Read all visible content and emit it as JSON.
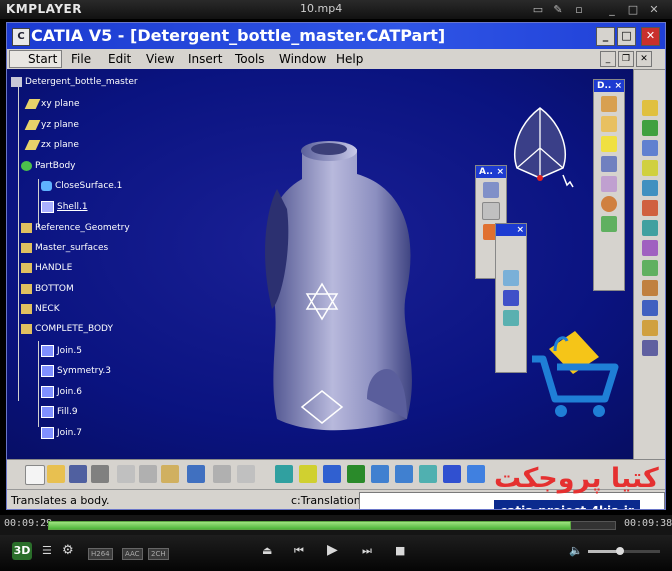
{
  "player": {
    "logo": "KMPLAYER",
    "file": "10.mp4",
    "time_current": "00:09:29",
    "time_total": "00:09:38",
    "progress": 0.92,
    "badges": [
      "H264",
      "AAC",
      "2CH"
    ],
    "btn_3d": "3D",
    "volume": 0.45
  },
  "catia": {
    "title": "CATIA V5 - [Detergent_bottle_master.CATPart]",
    "menu": [
      "Start",
      "File",
      "Edit",
      "View",
      "Insert",
      "Tools",
      "Window",
      "Help"
    ],
    "status_text": "Translates a body.",
    "cmd_label": "c:Translation",
    "cmd_value": ""
  },
  "tree": {
    "root": "Detergent_bottle_master",
    "items": [
      "xy plane",
      "yz plane",
      "zx plane",
      "PartBody",
      "CloseSurface.1",
      "Shell.1",
      "Reference_Geometry",
      "Master_surfaces",
      "HANDLE",
      "BOTTOM",
      "NECK",
      "COMPLETE_BODY",
      "Join.5",
      "Symmetry.3",
      "Join.6",
      "Fill.9",
      "Join.7"
    ]
  },
  "toolbars": {
    "d_label": "D..",
    "a_label": "A..",
    "close": "×"
  },
  "watermark": {
    "title": "کتیا پروجکت",
    "url": "catia-project.4kia.ir"
  },
  "colors": {
    "viewport_bg": "#0a1380",
    "title_blue": "#1b3ad0",
    "seek_green": "#4eb53a",
    "cart_blue": "#1f7fd6",
    "bag_yellow": "#f5c518",
    "watermark_red": "#e53030"
  }
}
